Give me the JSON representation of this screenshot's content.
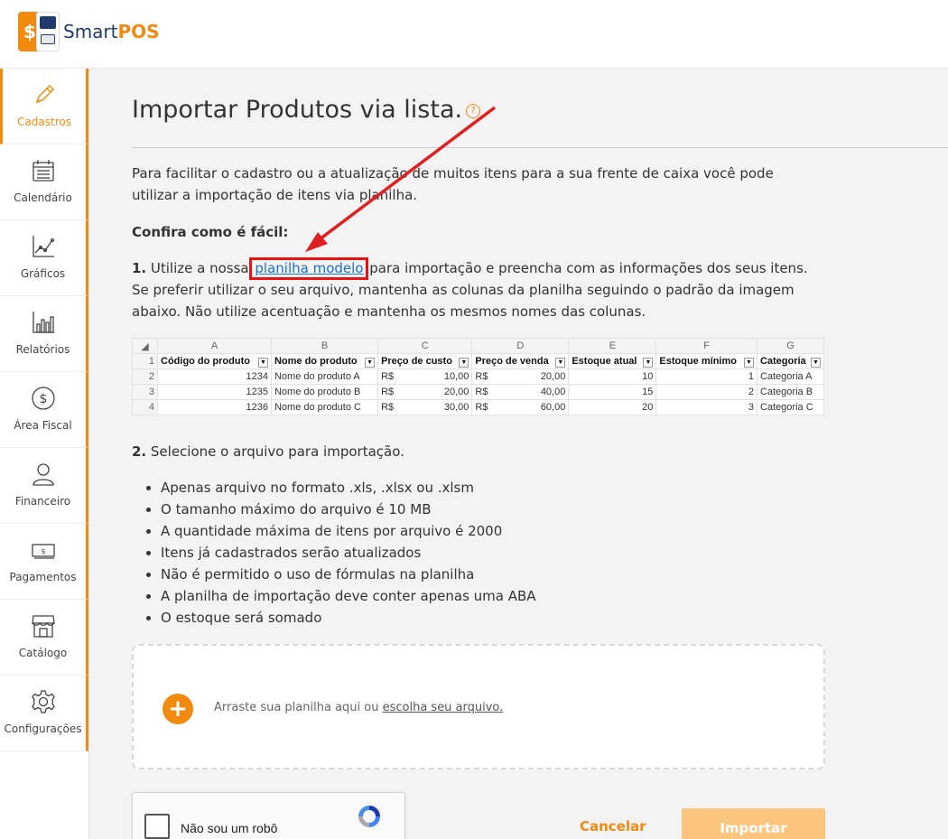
{
  "app": {
    "logo_prefix": "Smart",
    "logo_suffix": "POS",
    "accent_color": "#f28a0f"
  },
  "sidebar": {
    "items": [
      {
        "label": "Cadastros",
        "icon": "pencil-icon",
        "active": true
      },
      {
        "label": "Calendário",
        "icon": "calendar-icon"
      },
      {
        "label": "Gráficos",
        "icon": "chart-line-icon"
      },
      {
        "label": "Relatórios",
        "icon": "bar-chart-icon"
      },
      {
        "label": "Área Fiscal",
        "icon": "dollar-circle-icon"
      },
      {
        "label": "Financeiro",
        "icon": "person-icon"
      },
      {
        "label": "Pagamentos",
        "icon": "banknote-icon"
      },
      {
        "label": "Catálogo",
        "icon": "store-icon"
      },
      {
        "label": "Configurações",
        "icon": "gear-icon"
      }
    ]
  },
  "page": {
    "title": "Importar Produtos via lista.",
    "help_icon": "?",
    "intro": "Para facilitar o cadastro ou a atualização de muitos itens para a sua frente de caixa você pode utilizar a importação de itens via planilha.",
    "confira": "Confira como é fácil:",
    "step1_num": "1.",
    "step1_before": " Utilize a nossa ",
    "step1_link": "planilha modelo",
    "step1_after": " para importação e preencha com as informações dos seus itens. Se preferir utilizar o seu arquivo, mantenha as colunas da planilha seguindo o padrão da imagem abaixo. Não utilize acentuação e mantenha os mesmos nomes das colunas.",
    "step2_num": "2.",
    "step2_text": " Selecione o arquivo para importação."
  },
  "sheet": {
    "col_letters": [
      "A",
      "B",
      "C",
      "D",
      "E",
      "F",
      "G"
    ],
    "headers": [
      "Código do produto",
      "Nome do produto",
      "Preço de custo",
      "Preço de venda",
      "Estoque atual",
      "Estoque mínimo",
      "Categoria"
    ],
    "rows": [
      {
        "n": "2",
        "codigo": "1234",
        "nome": "Nome do produto A",
        "cur1": "R$",
        "custo": "10,00",
        "cur2": "R$",
        "venda": "20,00",
        "estoque": "10",
        "minimo": "1",
        "categoria": "Categoria A"
      },
      {
        "n": "3",
        "codigo": "1235",
        "nome": "Nome do produto B",
        "cur1": "R$",
        "custo": "20,00",
        "cur2": "R$",
        "venda": "40,00",
        "estoque": "15",
        "minimo": "2",
        "categoria": "Categoria B"
      },
      {
        "n": "4",
        "codigo": "1236",
        "nome": "Nome do produto C",
        "cur1": "R$",
        "custo": "30,00",
        "cur2": "R$",
        "venda": "60,00",
        "estoque": "20",
        "minimo": "3",
        "categoria": "Categoria C"
      }
    ],
    "header_row_num": "1"
  },
  "rules": [
    "Apenas arquivo no formato .xls, .xlsx ou .xlsm",
    "O tamanho máximo do arquivo é 10 MB",
    "A quantidade máxima de itens por arquivo é 2000",
    "Itens já cadastrados serão atualizados",
    "Não é permitido o uso de fórmulas na planilha",
    "A planilha de importação deve conter apenas uma ABA",
    "O estoque será somado"
  ],
  "dropzone": {
    "text": "Arraste sua planilha aqui ou ",
    "link": "escolha seu arquivo."
  },
  "captcha": {
    "label": "Não sou um robô"
  },
  "actions": {
    "cancel": "Cancelar",
    "import": "Importar"
  }
}
